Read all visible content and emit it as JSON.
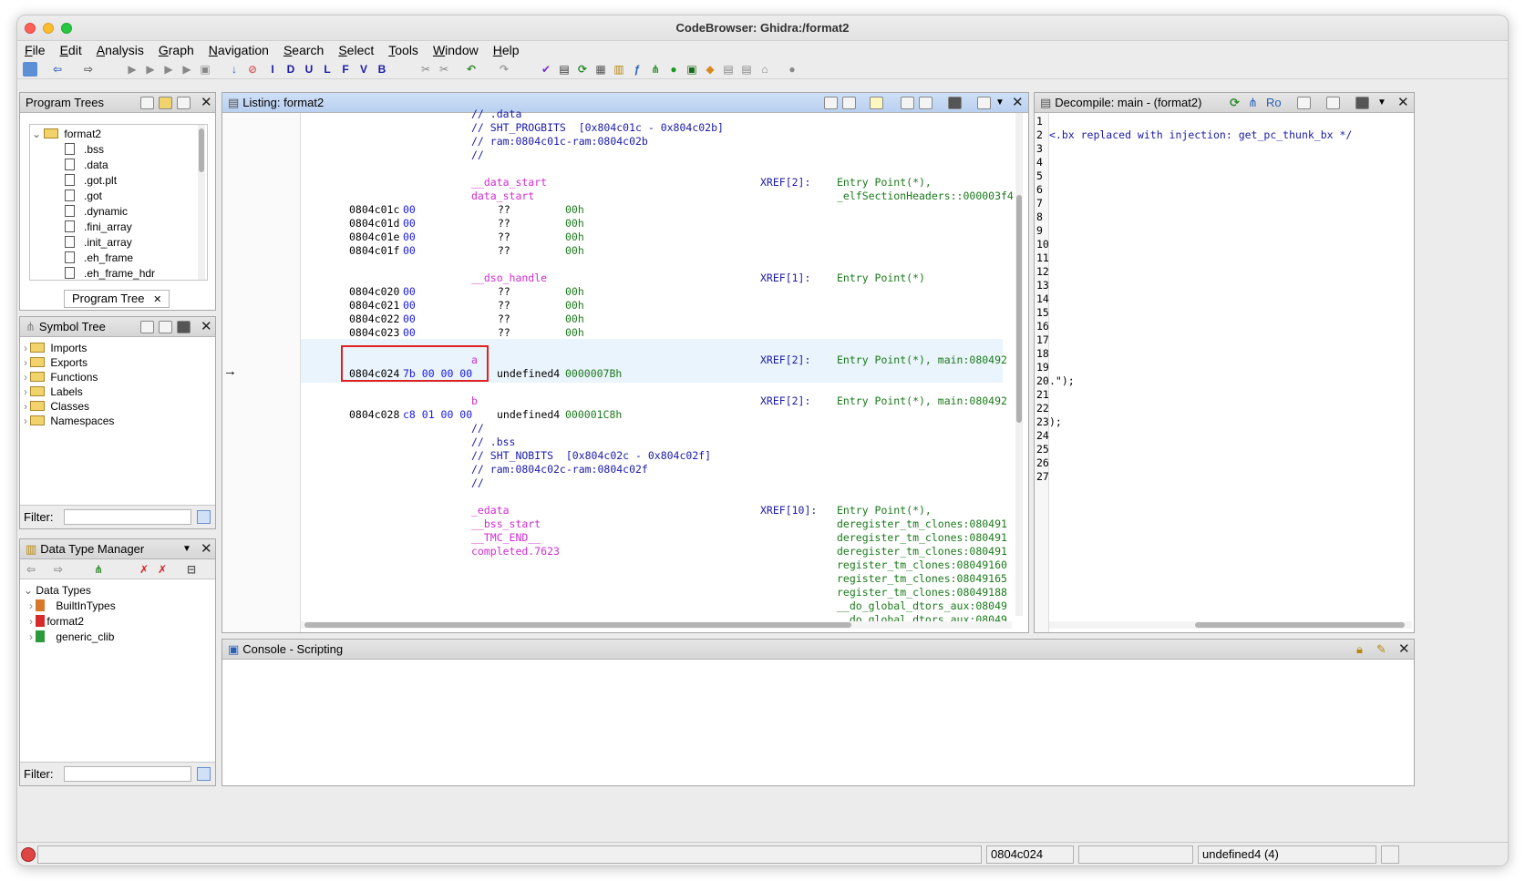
{
  "window": {
    "title": "CodeBrowser: Ghidra:/format2"
  },
  "menu": [
    "File",
    "Edit",
    "Analysis",
    "Graph",
    "Navigation",
    "Search",
    "Select",
    "Tools",
    "Window",
    "Help"
  ],
  "program_trees": {
    "title": "Program Trees",
    "root": "format2",
    "items": [
      ".bss",
      ".data",
      ".got.plt",
      ".got",
      ".dynamic",
      ".fini_array",
      ".init_array",
      ".eh_frame",
      ".eh_frame_hdr"
    ],
    "tab_label": "Program Tree"
  },
  "symbol_tree": {
    "title": "Symbol Tree",
    "items": [
      "Imports",
      "Exports",
      "Functions",
      "Labels",
      "Classes",
      "Namespaces"
    ],
    "filter_label": "Filter:"
  },
  "data_type_manager": {
    "title": "Data Type Manager",
    "root": "Data Types",
    "items": [
      "BuiltInTypes",
      "format2",
      "generic_clib"
    ],
    "filter_label": "Filter:"
  },
  "listing": {
    "title": "Listing:  format2",
    "lines": [
      {
        "addr": "",
        "bytes": "",
        "mnem": "",
        "operand": "",
        "text": "// .data",
        "cls": "c-comment",
        "xref": "",
        "xtext": ""
      },
      {
        "addr": "",
        "bytes": "",
        "mnem": "",
        "operand": "",
        "text": "// SHT_PROGBITS  [0x804c01c - 0x804c02b]",
        "cls": "c-comment",
        "xref": "",
        "xtext": ""
      },
      {
        "addr": "",
        "bytes": "",
        "mnem": "",
        "operand": "",
        "text": "// ram:0804c01c-ram:0804c02b",
        "cls": "c-comment",
        "xref": "",
        "xtext": ""
      },
      {
        "addr": "",
        "bytes": "",
        "mnem": "",
        "operand": "",
        "text": "//",
        "cls": "c-comment",
        "xref": "",
        "xtext": ""
      },
      {
        "addr": "",
        "bytes": "",
        "mnem": "",
        "operand": "",
        "text": "",
        "cls": "",
        "xref": "",
        "xtext": ""
      },
      {
        "addr": "",
        "bytes": "",
        "mnem": "",
        "operand": "",
        "text": "__data_start",
        "cls": "c-label",
        "xref": "XREF[2]:",
        "xtext": "Entry Point(*),"
      },
      {
        "addr": "",
        "bytes": "",
        "mnem": "",
        "operand": "",
        "text": "data_start",
        "cls": "c-label",
        "xref": "",
        "xtext": "_elfSectionHeaders::000003f4"
      },
      {
        "addr": "0804c01c",
        "bytes": "00",
        "mnem": "??",
        "operand": "00h",
        "text": "",
        "cls": "",
        "xref": "",
        "xtext": ""
      },
      {
        "addr": "0804c01d",
        "bytes": "00",
        "mnem": "??",
        "operand": "00h",
        "text": "",
        "cls": "",
        "xref": "",
        "xtext": ""
      },
      {
        "addr": "0804c01e",
        "bytes": "00",
        "mnem": "??",
        "operand": "00h",
        "text": "",
        "cls": "",
        "xref": "",
        "xtext": ""
      },
      {
        "addr": "0804c01f",
        "bytes": "00",
        "mnem": "??",
        "operand": "00h",
        "text": "",
        "cls": "",
        "xref": "",
        "xtext": ""
      },
      {
        "addr": "",
        "bytes": "",
        "mnem": "",
        "operand": "",
        "text": "",
        "cls": "",
        "xref": "",
        "xtext": ""
      },
      {
        "addr": "",
        "bytes": "",
        "mnem": "",
        "operand": "",
        "text": "__dso_handle",
        "cls": "c-label",
        "xref": "XREF[1]:",
        "xtext": "Entry Point(*)"
      },
      {
        "addr": "0804c020",
        "bytes": "00",
        "mnem": "??",
        "operand": "00h",
        "text": "",
        "cls": "",
        "xref": "",
        "xtext": ""
      },
      {
        "addr": "0804c021",
        "bytes": "00",
        "mnem": "??",
        "operand": "00h",
        "text": "",
        "cls": "",
        "xref": "",
        "xtext": ""
      },
      {
        "addr": "0804c022",
        "bytes": "00",
        "mnem": "??",
        "operand": "00h",
        "text": "",
        "cls": "",
        "xref": "",
        "xtext": ""
      },
      {
        "addr": "0804c023",
        "bytes": "00",
        "mnem": "??",
        "operand": "00h",
        "text": "",
        "cls": "",
        "xref": "",
        "xtext": ""
      },
      {
        "addr": "",
        "bytes": "",
        "mnem": "",
        "operand": "",
        "text": "",
        "cls": "",
        "xref": "",
        "xtext": ""
      },
      {
        "addr": "",
        "bytes": "",
        "mnem": "",
        "operand": "",
        "text": "a",
        "cls": "c-label",
        "xref": "XREF[2]:",
        "xtext": "Entry Point(*), main:080492"
      },
      {
        "addr": "0804c024",
        "bytes": "7b 00 00 00",
        "mnem": "undefined4",
        "operand": "0000007Bh",
        "text": "",
        "cls": "",
        "xref": "",
        "xtext": ""
      },
      {
        "addr": "",
        "bytes": "",
        "mnem": "",
        "operand": "",
        "text": "",
        "cls": "",
        "xref": "",
        "xtext": ""
      },
      {
        "addr": "",
        "bytes": "",
        "mnem": "",
        "operand": "",
        "text": "b",
        "cls": "c-label",
        "xref": "XREF[2]:",
        "xtext": "Entry Point(*), main:080492"
      },
      {
        "addr": "0804c028",
        "bytes": "c8 01 00 00",
        "mnem": "undefined4",
        "operand": "000001C8h",
        "text": "",
        "cls": "",
        "xref": "",
        "xtext": ""
      },
      {
        "addr": "",
        "bytes": "",
        "mnem": "",
        "operand": "",
        "text": "//",
        "cls": "c-comment",
        "xref": "",
        "xtext": ""
      },
      {
        "addr": "",
        "bytes": "",
        "mnem": "",
        "operand": "",
        "text": "// .bss",
        "cls": "c-comment",
        "xref": "",
        "xtext": ""
      },
      {
        "addr": "",
        "bytes": "",
        "mnem": "",
        "operand": "",
        "text": "// SHT_NOBITS  [0x804c02c - 0x804c02f]",
        "cls": "c-comment",
        "xref": "",
        "xtext": ""
      },
      {
        "addr": "",
        "bytes": "",
        "mnem": "",
        "operand": "",
        "text": "// ram:0804c02c-ram:0804c02f",
        "cls": "c-comment",
        "xref": "",
        "xtext": ""
      },
      {
        "addr": "",
        "bytes": "",
        "mnem": "",
        "operand": "",
        "text": "//",
        "cls": "c-comment",
        "xref": "",
        "xtext": ""
      },
      {
        "addr": "",
        "bytes": "",
        "mnem": "",
        "operand": "",
        "text": "",
        "cls": "",
        "xref": "",
        "xtext": ""
      },
      {
        "addr": "",
        "bytes": "",
        "mnem": "",
        "operand": "",
        "text": "_edata",
        "cls": "c-label",
        "xref": "XREF[10]:",
        "xtext": "Entry Point(*),"
      },
      {
        "addr": "",
        "bytes": "",
        "mnem": "",
        "operand": "",
        "text": "__bss_start",
        "cls": "c-label",
        "xref": "",
        "xtext": "deregister_tm_clones:080491"
      },
      {
        "addr": "",
        "bytes": "",
        "mnem": "",
        "operand": "",
        "text": "__TMC_END__",
        "cls": "c-label",
        "xref": "",
        "xtext": "deregister_tm_clones:080491"
      },
      {
        "addr": "",
        "bytes": "",
        "mnem": "",
        "operand": "",
        "text": "completed.7623",
        "cls": "c-label",
        "xref": "",
        "xtext": "deregister_tm_clones:080491"
      },
      {
        "addr": "",
        "bytes": "",
        "mnem": "",
        "operand": "",
        "text": "",
        "cls": "",
        "xref": "",
        "xtext": "register_tm_clones:08049160"
      },
      {
        "addr": "",
        "bytes": "",
        "mnem": "",
        "operand": "",
        "text": "",
        "cls": "",
        "xref": "",
        "xtext": "register_tm_clones:08049165"
      },
      {
        "addr": "",
        "bytes": "",
        "mnem": "",
        "operand": "",
        "text": "",
        "cls": "",
        "xref": "",
        "xtext": "register_tm_clones:08049188"
      },
      {
        "addr": "",
        "bytes": "",
        "mnem": "",
        "operand": "",
        "text": "",
        "cls": "",
        "xref": "",
        "xtext": "__do_global_dtors_aux:08049"
      },
      {
        "addr": "",
        "bytes": "",
        "mnem": "",
        "operand": "",
        "text": "",
        "cls": "",
        "xref": "",
        "xtext": "__do_global_dtors_aux:08049"
      }
    ]
  },
  "decompile": {
    "title": "Decompile: main -  (format2)",
    "ro_label": "Ro",
    "line_numbers": [
      "1",
      "2",
      "3",
      "4",
      "5",
      "6",
      "7",
      "8",
      "9",
      "10",
      "11",
      "12",
      "13",
      "14",
      "15",
      "16",
      "17",
      "18",
      "19",
      "20",
      "21",
      "22",
      "23",
      "24",
      "25",
      "26",
      "27"
    ],
    "code": {
      "1": "",
      "2": "<.bx replaced with injection: get_pc_thunk_bx */",
      "20": ".\");",
      "23": ");"
    }
  },
  "console": {
    "title": "Console - Scripting"
  },
  "status": {
    "address": "0804c024",
    "type": "undefined4  (4)"
  },
  "colors": {
    "label": "#d12bd1",
    "comment": "#1a1aa8",
    "bytes": "#1717e8",
    "operand": "#1a7a1a",
    "highlight": "#e02020"
  }
}
